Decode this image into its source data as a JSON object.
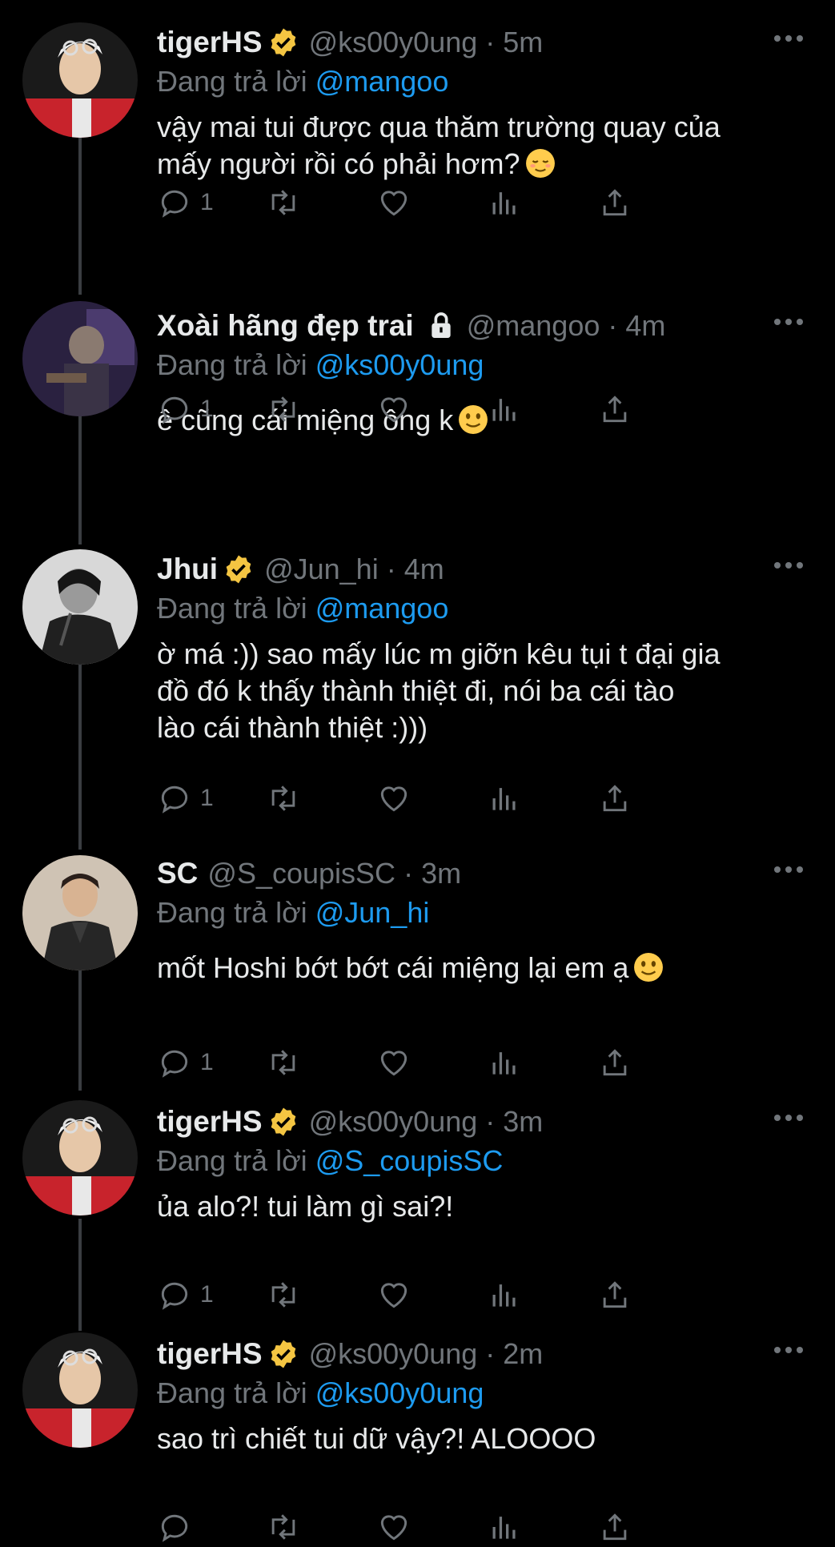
{
  "colors": {
    "background": "#000000",
    "text": "#e7e9ea",
    "muted": "#71767b",
    "link": "#1d9bf0",
    "verified": "#f4c542"
  },
  "replying_label": "Đang trả lời",
  "tweets": [
    {
      "name": "tigerHS",
      "handle": "@ks00y0ung",
      "time": "5m",
      "reply_to": "@mangoo",
      "text": [
        "vậy mai tui được qua thăm trường quay của",
        "mấy người rồi có phải hơm?"
      ],
      "emoji": "relieved-face",
      "reply_count": "1",
      "verified": true
    },
    {
      "name": "Xoài hãng đẹp trai",
      "handle": "@mangoo",
      "time": "4m",
      "reply_to": "@ks00y0ung",
      "text": [
        "ê cũng cái miệng ông k"
      ],
      "emoji": "slight-smile",
      "reply_count": "1",
      "locked": true
    },
    {
      "name": "Jhui",
      "handle": "@Jun_hi",
      "time": "4m",
      "reply_to": "@mangoo",
      "text": [
        "ờ má :)) sao mấy lúc m giỡn kêu tụi t đại gia",
        "đồ đó k thấy thành thiệt đi, nói ba cái tào",
        "lào cái thành thiệt :)))"
      ],
      "reply_count": "1",
      "verified": true
    },
    {
      "name": "SC",
      "handle": "@S_coupisSC",
      "time": "3m",
      "reply_to": "@Jun_hi",
      "text": [
        "mốt Hoshi bớt bớt cái miệng lại em ạ"
      ],
      "emoji": "slight-smile",
      "reply_count": "1"
    },
    {
      "name": "tigerHS",
      "handle": "@ks00y0ung",
      "time": "3m",
      "reply_to": "@S_coupisSC",
      "text": [
        "ủa alo?! tui làm gì sai?!"
      ],
      "reply_count": "1",
      "verified": true
    },
    {
      "name": "tigerHS",
      "handle": "@ks00y0ung",
      "time": "2m",
      "reply_to": "@ks00y0ung",
      "text": [
        "sao trì chiết tui dữ vậy?! ALOOOO"
      ],
      "reply_count": "",
      "verified": true
    }
  ]
}
